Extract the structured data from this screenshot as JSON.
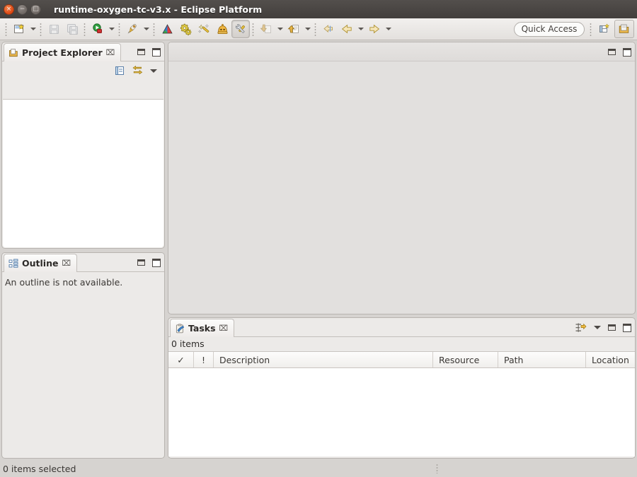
{
  "window": {
    "title": "runtime-oxygen-tc-v3.x - Eclipse Platform",
    "buttons": {
      "close": "×",
      "minimize": "−",
      "maximize": "□"
    }
  },
  "toolbar": {
    "items": [
      {
        "name": "new-wizard-icon",
        "label": "New"
      },
      {
        "name": "new-dropdown-arrow",
        "label": "New menu"
      },
      {
        "name": "save-icon",
        "label": "Save"
      },
      {
        "name": "save-all-icon",
        "label": "Save All"
      },
      {
        "name": "run-icon",
        "label": "Run"
      },
      {
        "name": "run-dropdown-arrow",
        "label": "Run menu"
      },
      {
        "name": "debug-icon",
        "label": "Debug"
      },
      {
        "name": "debug-dropdown-arrow",
        "label": "Debug menu"
      },
      {
        "name": "triangle-icon",
        "label": "Generate"
      },
      {
        "name": "gears-icon",
        "label": "Build"
      },
      {
        "name": "wand-icon",
        "label": "Transform"
      },
      {
        "name": "dome-icon",
        "label": "Validate"
      },
      {
        "name": "tools-icon",
        "label": "Tools"
      },
      {
        "name": "import-icon",
        "label": "Import"
      },
      {
        "name": "import-dropdown-arrow",
        "label": "Import menu"
      },
      {
        "name": "export-icon",
        "label": "Export"
      },
      {
        "name": "export-dropdown-arrow",
        "label": "Export menu"
      },
      {
        "name": "back-nav-icon",
        "label": "Back"
      },
      {
        "name": "previous-icon",
        "label": "Previous Annotation"
      },
      {
        "name": "previous-dropdown-arrow",
        "label": "Previous menu"
      },
      {
        "name": "next-icon",
        "label": "Next Annotation"
      },
      {
        "name": "next-dropdown-arrow",
        "label": "Next menu"
      }
    ],
    "quick_access": {
      "label": "Quick Access",
      "placeholder": "Quick Access"
    },
    "open_perspective_label": "Open Perspective",
    "perspective_switch_label": "Resource"
  },
  "project_explorer": {
    "tab_label": "Project Explorer",
    "close_glyph": "⌧",
    "toolbar": [
      {
        "name": "collapse-all-icon",
        "label": "Collapse All"
      },
      {
        "name": "link-with-editor-icon",
        "label": "Link with Editor"
      },
      {
        "name": "view-menu-icon",
        "label": "View Menu"
      }
    ],
    "controls": [
      {
        "name": "minimize-icon",
        "label": "Minimize"
      },
      {
        "name": "maximize-icon",
        "label": "Maximize"
      }
    ],
    "items": []
  },
  "outline": {
    "tab_label": "Outline",
    "close_glyph": "⌧",
    "message": "An outline is not available.",
    "controls": [
      {
        "name": "minimize-icon",
        "label": "Minimize"
      },
      {
        "name": "maximize-icon",
        "label": "Maximize"
      }
    ]
  },
  "editor_area": {
    "controls": [
      {
        "name": "minimize-icon",
        "label": "Minimize"
      },
      {
        "name": "maximize-icon",
        "label": "Maximize"
      }
    ]
  },
  "tasks": {
    "tab_label": "Tasks",
    "close_glyph": "⌧",
    "count_text": "0 items",
    "toolbar": [
      {
        "name": "filters-icon",
        "label": "Filters"
      },
      {
        "name": "view-menu-icon",
        "label": "View Menu"
      },
      {
        "name": "minimize-icon",
        "label": "Minimize"
      },
      {
        "name": "maximize-icon",
        "label": "Maximize"
      }
    ],
    "columns": [
      {
        "key": "check",
        "label": "✓"
      },
      {
        "key": "priority",
        "label": "!"
      },
      {
        "key": "description",
        "label": "Description"
      },
      {
        "key": "resource",
        "label": "Resource"
      },
      {
        "key": "path",
        "label": "Path"
      },
      {
        "key": "location",
        "label": "Location"
      }
    ],
    "rows": []
  },
  "statusbar": {
    "text": "0 items selected"
  },
  "colors": {
    "titlebar": "#483f3c",
    "close_button": "#dd4814",
    "toolbar_bg": "#eae7e4",
    "panel_bg": "#eceae8",
    "editor_bg": "#e2e0de",
    "table_bg": "#ffffff",
    "border": "#b8b4b0"
  }
}
